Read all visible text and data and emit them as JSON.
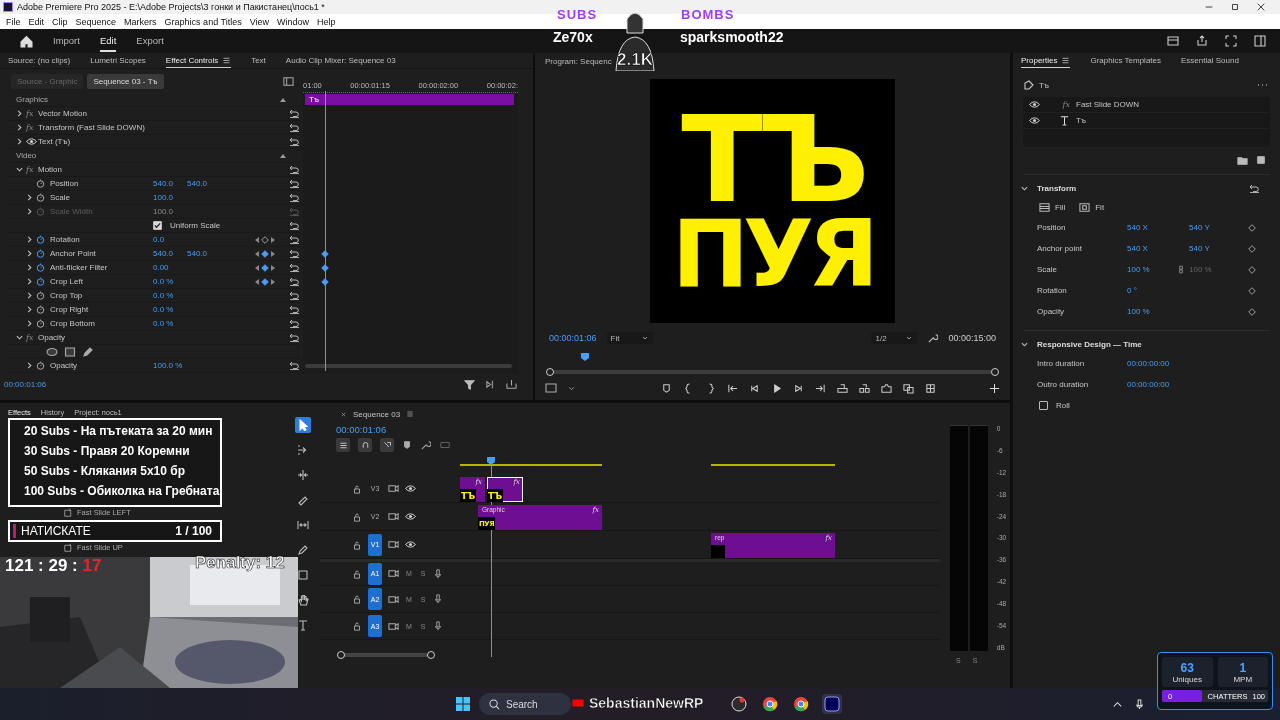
{
  "window": {
    "title": "Adobe Premiere Pro 2025 - E:\\Adobe Projects\\3 гонки и Пакистанец\\пось1 *"
  },
  "menu": [
    "File",
    "Edit",
    "Clip",
    "Sequence",
    "Markers",
    "Graphics and Titles",
    "View",
    "Window",
    "Help"
  ],
  "workspaces": [
    {
      "label": "Import",
      "selected": false
    },
    {
      "label": "Edit",
      "selected": true
    },
    {
      "label": "Export",
      "selected": false
    }
  ],
  "effect_controls": {
    "tabs": [
      {
        "label": "Source: (no clips)",
        "selected": false
      },
      {
        "label": "Lumetri Scopes",
        "selected": false
      },
      {
        "label": "Effect Controls",
        "selected": true
      },
      {
        "label": "Text",
        "selected": false
      },
      {
        "label": "Audio Clip Mixer: Sequence 03",
        "selected": false
      }
    ],
    "sources": [
      {
        "label": "Source - Graphic",
        "selected": false
      },
      {
        "label": "Sequence 03 - Тъ",
        "selected": true
      }
    ],
    "ruler": [
      "01:00",
      "00:00:01:15",
      "00:00:02:00",
      "00:00:02:"
    ],
    "clip": "Тъ",
    "rows": [
      {
        "kind": "section",
        "label": "Graphics"
      },
      {
        "kind": "effect",
        "badge": "fx",
        "label": "Vector Motion",
        "expanded": false
      },
      {
        "kind": "effect",
        "badge": "fx",
        "label": "Transform (Fast Slide DOWN)",
        "expanded": false
      },
      {
        "kind": "layer",
        "label": "Text (Тъ)",
        "expanded": false
      },
      {
        "kind": "section",
        "label": "Video"
      },
      {
        "kind": "effect",
        "badge": "fx",
        "label": "Motion",
        "expanded": true
      },
      {
        "kind": "property",
        "label": "Position",
        "values": [
          "540.0",
          "540.0"
        ],
        "animated": false,
        "disabled": false
      },
      {
        "kind": "property",
        "label": "Scale",
        "values": [
          "100.0"
        ],
        "expanded": false,
        "animated": false,
        "disabled": false
      },
      {
        "kind": "property",
        "label": "Scale Width",
        "values": [
          "100.0"
        ],
        "expanded": false,
        "animated": false,
        "disabled": true
      },
      {
        "kind": "checkbox",
        "label": "Uniform Scale",
        "checked": true
      },
      {
        "kind": "property",
        "label": "Rotation",
        "values": [
          "0.0"
        ],
        "expanded": false,
        "animated": true,
        "keyframe": false,
        "disabled": false
      },
      {
        "kind": "property",
        "label": "Anchor Point",
        "values": [
          "540.0",
          "540.0"
        ],
        "expanded": false,
        "animated": true,
        "keyframe": true,
        "disabled": false
      },
      {
        "kind": "property",
        "label": "Anti-flicker Filter",
        "values": [
          "0.00"
        ],
        "expanded": false,
        "animated": true,
        "keyframe": true,
        "disabled": false
      },
      {
        "kind": "property",
        "label": "Crop Left",
        "values": [
          "0.0 %"
        ],
        "expanded": false,
        "animated": true,
        "keyframe": true,
        "disabled": false
      },
      {
        "kind": "property",
        "label": "Crop Top",
        "values": [
          "0.0 %"
        ],
        "expanded": false,
        "animated": false,
        "disabled": false
      },
      {
        "kind": "property",
        "label": "Crop Right",
        "values": [
          "0.0 %"
        ],
        "expanded": false,
        "animated": false,
        "disabled": false
      },
      {
        "kind": "property",
        "label": "Crop Bottom",
        "values": [
          "0.0 %"
        ],
        "expanded": false,
        "animated": false,
        "disabled": false
      },
      {
        "kind": "effect",
        "badge": "fx",
        "label": "Opacity",
        "expanded": true
      },
      {
        "kind": "masks"
      },
      {
        "kind": "property",
        "label": "Opacity",
        "values": [
          "100.0 %"
        ],
        "expanded": false,
        "animated": false,
        "disabled": false
      }
    ],
    "timecode": "00:00:01:06"
  },
  "program_monitor": {
    "title": "Program: Sequenc",
    "frame_lines": [
      "ТЪ",
      "ПУЯ"
    ],
    "timecode": "00:00:01:06",
    "zoom": "Fit",
    "resolution": "1/2",
    "duration": "00:00:15:00"
  },
  "properties": {
    "tabs": [
      {
        "label": "Properties",
        "selected": true
      },
      {
        "label": "Graphics Templates",
        "selected": false
      },
      {
        "label": "Essential Sound",
        "selected": false
      }
    ],
    "clip": "Тъ",
    "layers": [
      {
        "kind": "effect",
        "badge": "fx",
        "label": "Fast Slide DOWN",
        "visible": true
      },
      {
        "kind": "text",
        "label": "Тъ",
        "visible": true
      }
    ],
    "transform": {
      "title": "Transform",
      "expanded": true,
      "fit_modes": [
        "Fill",
        "Fit"
      ],
      "rows": [
        {
          "label": "Position",
          "values": [
            "540 X",
            "540 Y"
          ]
        },
        {
          "label": "Anchor point",
          "values": [
            "540 X",
            "540 Y"
          ]
        },
        {
          "label": "Scale",
          "values": [
            "100 %"
          ],
          "linked_value": "100 %"
        },
        {
          "label": "Rotation",
          "values": [
            "0 °"
          ]
        },
        {
          "label": "Opacity",
          "values": [
            "100 %"
          ]
        }
      ]
    },
    "responsive": {
      "title": "Responsive Design — Time",
      "expanded": true,
      "rows": [
        {
          "label": "Intro duration",
          "value": "00:00:00:00"
        },
        {
          "label": "Outro duration",
          "value": "00:00:00:00"
        }
      ],
      "roll": {
        "label": "Roll",
        "checked": false
      }
    }
  },
  "project_panel": {
    "tabs": [
      {
        "label": "Effects",
        "selected": true
      },
      {
        "label": "History",
        "selected": false
      },
      {
        "label": "Project: пось1",
        "selected": false
      }
    ],
    "items": [
      "Fast Slide LEFT",
      "Fast Slide UP"
    ]
  },
  "tools": [
    {
      "kind": "select",
      "selected": true
    },
    {
      "kind": "track-select",
      "selected": false
    },
    {
      "kind": "ripple",
      "selected": false
    },
    {
      "kind": "razor",
      "selected": false
    },
    {
      "kind": "slip",
      "selected": false
    },
    {
      "kind": "pen",
      "selected": false
    },
    {
      "kind": "rectangle",
      "selected": false
    },
    {
      "kind": "hand",
      "selected": false
    },
    {
      "kind": "type",
      "selected": false
    }
  ],
  "timeline": {
    "title": "Sequence 03",
    "timecode": "00:00:01:06",
    "tracks": [
      {
        "kind": "video",
        "name": "V3",
        "targeted": false,
        "clips": [
          {
            "badge": "fx",
            "thumb": "ТЪ",
            "selected": false
          },
          {
            "badge": "fx",
            "thumb": "ТЪ",
            "selected": true
          }
        ]
      },
      {
        "kind": "video",
        "name": "V2",
        "targeted": false,
        "clips": [
          {
            "label": "Graphic",
            "badge": "fx",
            "thumb": "ПУЯ",
            "selected": false
          }
        ]
      },
      {
        "kind": "video",
        "name": "V1",
        "targeted": true,
        "clips": [
          {
            "label": "rep",
            "badge": "fx",
            "selected": false
          }
        ]
      },
      {
        "kind": "audio",
        "name": "A1",
        "targeted": true,
        "mute": "M",
        "solo": "S"
      },
      {
        "kind": "audio",
        "name": "A2",
        "targeted": true,
        "mute": "M",
        "solo": "S"
      },
      {
        "kind": "audio",
        "name": "A3",
        "targeted": true,
        "mute": "M",
        "solo": "S"
      }
    ]
  },
  "audio_meter": {
    "scale": [
      "0",
      "-6",
      "-12",
      "-18",
      "-24",
      "-30",
      "-36",
      "-42",
      "-48",
      "-54",
      "dB"
    ],
    "channels": [
      "S",
      "S"
    ]
  },
  "taskbar": {
    "search": {
      "placeholder": "Search"
    }
  },
  "stream_overlay": {
    "subs": {
      "title": "SUBS",
      "name": "Ze70x"
    },
    "bombs": {
      "title": "BOMBS",
      "name": "sparksmooth22"
    },
    "count": "2.1K",
    "goals": [
      "20 Subs - На пътеката за 20 мин",
      "30 Subs - Правя 20 Коремни",
      "50 Subs - Клякания 5x10 бр",
      "100 Subs - Обиколка на Гребната"
    ],
    "counter": {
      "label": "НАТИСКАТЕ",
      "value": "1 / 100"
    },
    "timer": [
      {
        "text": "121 : 29 : ",
        "color": "#ffffff"
      },
      {
        "text": "17",
        "color": "#e0282c"
      }
    ],
    "penalty": "Penalty: 12",
    "channel": "SebastianNewRP",
    "stats": [
      {
        "value": "63",
        "label": "Uniques"
      },
      {
        "value": "1",
        "label": "MPM"
      }
    ],
    "chatters": {
      "min": "0",
      "label": "CHATTERS",
      "max": "100",
      "level": 0.38
    }
  }
}
